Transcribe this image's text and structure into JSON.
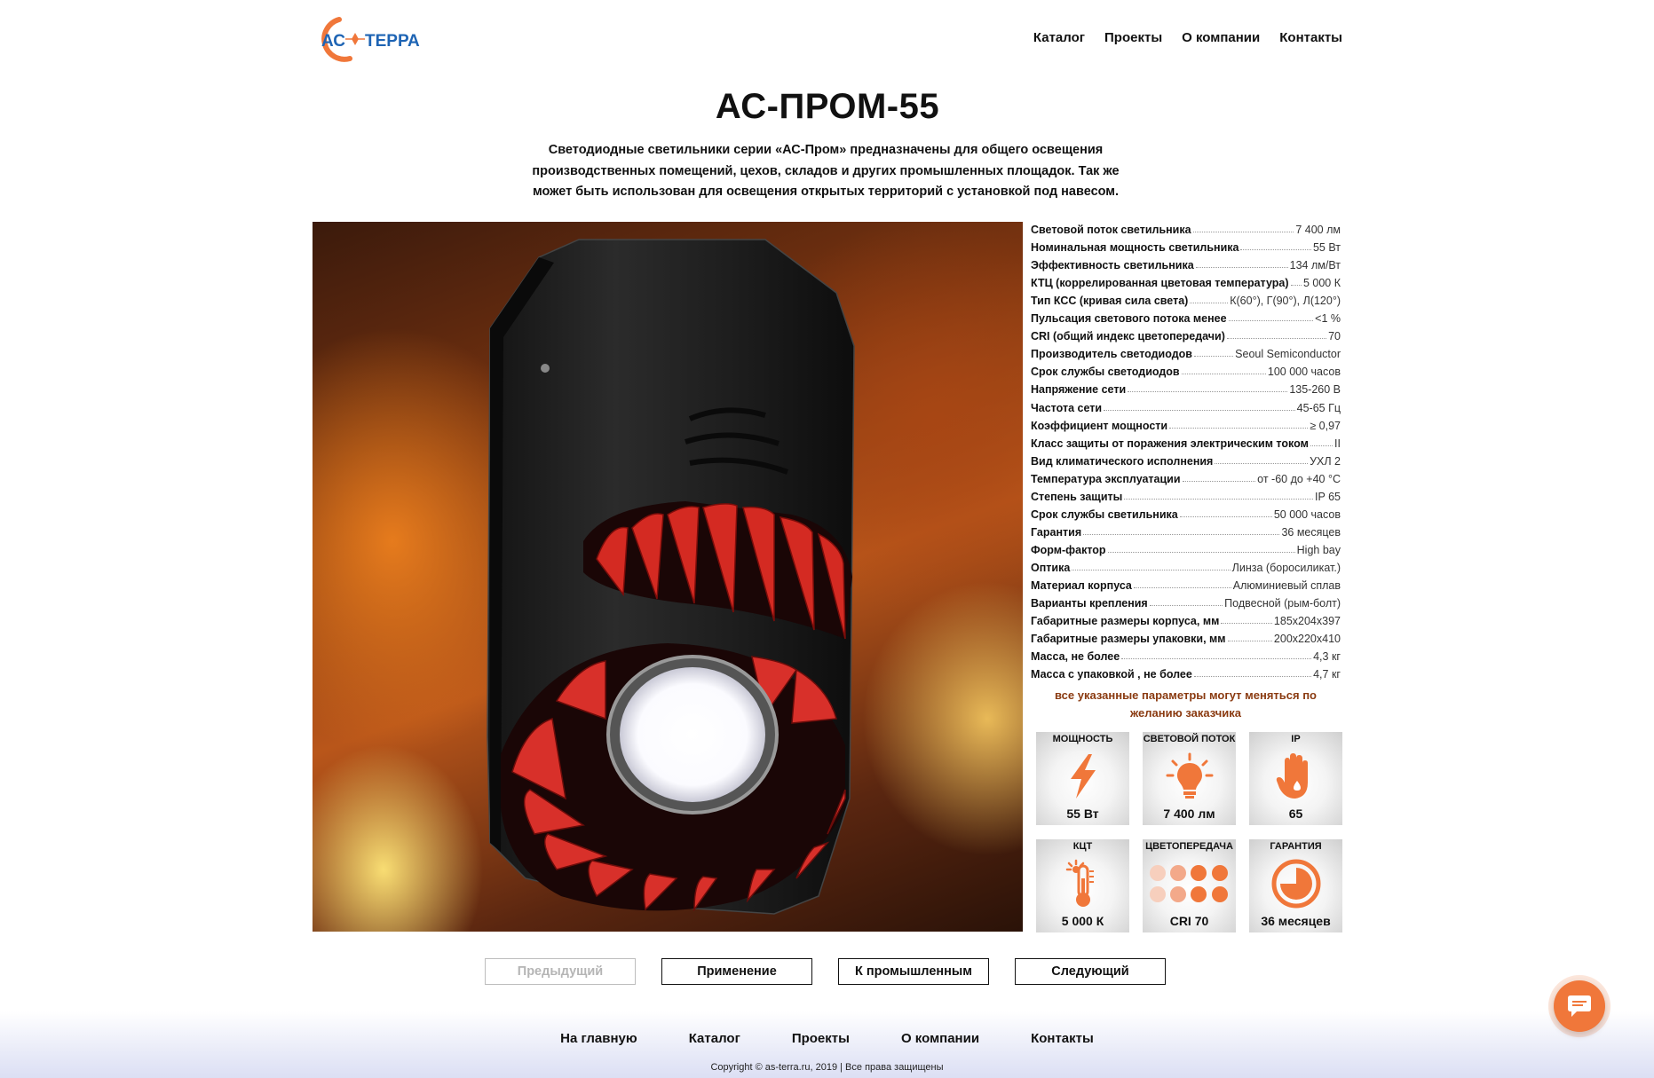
{
  "brand": {
    "logo_text_ac": "АС",
    "logo_text_terra": "ТЕРРА",
    "accent": "#f0773a",
    "logo_blue": "#1e64b4"
  },
  "nav": [
    "Каталог",
    "Проекты",
    "О компании",
    "Контакты"
  ],
  "title": "АС-ПРОМ-55",
  "description": "Светодиодные светильники серии «АС-Пром» предназначены для общего освещения производственных помещений, цехов, складов и других промышленных площадок. Так же может быть использован для освещения открытых территорий с установкой под навесом.",
  "specs": [
    {
      "k": "Световой поток светильника",
      "v": "7 400 лм"
    },
    {
      "k": "Номинальная мощность светильника",
      "v": "55 Вт"
    },
    {
      "k": "Эффективность светильника",
      "v": "134 лм/Вт"
    },
    {
      "k": "КТЦ (коррелированная цветовая температура)",
      "v": "5 000 К"
    },
    {
      "k": "Тип КСС (кривая сила света)",
      "v": "К(60°), Г(90°), Л(120°)"
    },
    {
      "k": "Пульсация светового потока менее",
      "v": "<1 %"
    },
    {
      "k": "CRI (общий индекс цветопередачи)",
      "v": "70"
    },
    {
      "k": "Производитель светодиодов",
      "v": "Seoul Semiconductor"
    },
    {
      "k": "Срок службы светодиодов",
      "v": "100 000 часов"
    },
    {
      "k": "Напряжение сети",
      "v": "135-260 В"
    },
    {
      "k": "Частота сети",
      "v": "45-65 Гц"
    },
    {
      "k": "Коэффициент мощности",
      "v": "≥ 0,97"
    },
    {
      "k": "Класс защиты от поражения электрическим током",
      "v": "II"
    },
    {
      "k": "Вид климатического исполнения",
      "v": "УХЛ 2"
    },
    {
      "k": "Температура эксплуатации",
      "v": "от -60 до +40 °С"
    },
    {
      "k": "Степень защиты",
      "v": "IP 65"
    },
    {
      "k": "Срок службы светильника",
      "v": "50 000 часов"
    },
    {
      "k": "Гарантия",
      "v": "36 месяцев"
    },
    {
      "k": "Форм-фактор",
      "v": "High bay"
    },
    {
      "k": "Оптика",
      "v": "Линза (боросиликат.)"
    },
    {
      "k": "Материал корпуса",
      "v": "Алюминиевый сплав"
    },
    {
      "k": "Варианты крепления",
      "v": "Подвесной (рым-болт)"
    },
    {
      "k": "Габаритные размеры корпуса, мм",
      "v": "185х204х397"
    },
    {
      "k": "Габаритные размеры упаковки, мм",
      "v": "200х220х410"
    },
    {
      "k": "Масса, не более",
      "v": "4,3 кг"
    },
    {
      "k": "Масса с упаковкой , не более",
      "v": "4,7 кг"
    }
  ],
  "note": "все указанные параметры могут меняться по желанию заказчика",
  "badges": [
    {
      "label": "МОЩНОСТЬ",
      "value": "55 Вт",
      "icon": "lightning-icon"
    },
    {
      "label": "СВЕТОВОЙ ПОТОК",
      "value": "7 400 лм",
      "icon": "bulb-icon"
    },
    {
      "label": "IP",
      "value": "65",
      "icon": "hand-water-icon"
    },
    {
      "label": "КЦТ",
      "value": "5 000 К",
      "icon": "thermometer-icon"
    },
    {
      "label": "ЦВЕТОПЕРЕДАЧА",
      "value": "CRI 70",
      "icon": "dots-icon"
    },
    {
      "label": "ГАРАНТИЯ",
      "value": "36 месяцев",
      "icon": "clock-icon"
    }
  ],
  "pager": {
    "prev": "Предыдущий",
    "application": "Применение",
    "to_industrial": "К промышленным",
    "next": "Следующий"
  },
  "footer": {
    "nav": [
      "На главную",
      "Каталог",
      "Проекты",
      "О компании",
      "Контакты"
    ],
    "copyright": "Copyright © as-terra.ru, 2019 | Все права защищены"
  }
}
